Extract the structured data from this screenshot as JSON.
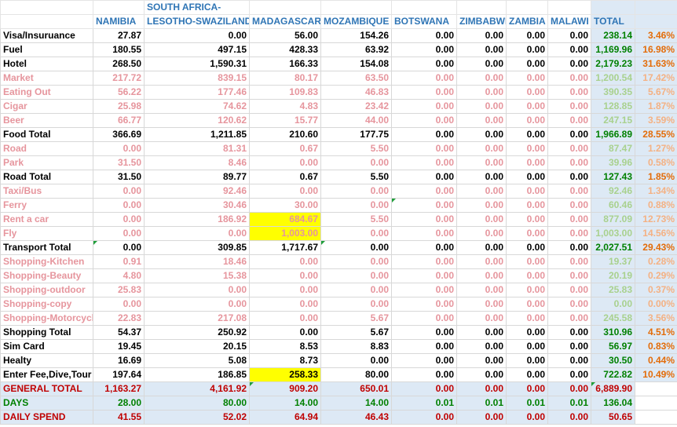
{
  "header": {
    "top": [
      "",
      "",
      "SOUTH AFRICA-",
      "",
      "",
      "",
      "",
      "",
      "",
      "",
      ""
    ],
    "bottom": [
      "",
      "NAMIBIA",
      "LESOTHO-SWAZILAND",
      "MADAGASCAR",
      "MOZAMBIQUE",
      "BOTSWANA",
      "ZIMBABWE",
      "ZAMBIA",
      "MALAWI",
      "TOTAL",
      ""
    ]
  },
  "rows": [
    {
      "style": "major",
      "cells": [
        "Visa/Insuruance",
        "27.87",
        "0.00",
        "56.00",
        "154.26",
        "0.00",
        "0.00",
        "0.00",
        "0.00",
        "238.14",
        "3.46%"
      ]
    },
    {
      "style": "major",
      "cells": [
        "Fuel",
        "180.55",
        "497.15",
        "428.33",
        "63.92",
        "0.00",
        "0.00",
        "0.00",
        "0.00",
        "1,169.96",
        "16.98%"
      ]
    },
    {
      "style": "major",
      "cells": [
        "Hotel",
        "268.50",
        "1,590.31",
        "166.33",
        "154.08",
        "0.00",
        "0.00",
        "0.00",
        "0.00",
        "2,179.23",
        "31.63%"
      ]
    },
    {
      "style": "sub",
      "cells": [
        "Market",
        "217.72",
        "839.15",
        "80.17",
        "63.50",
        "0.00",
        "0.00",
        "0.00",
        "0.00",
        "1,200.54",
        "17.42%"
      ]
    },
    {
      "style": "sub",
      "cells": [
        "Eating Out",
        "56.22",
        "177.46",
        "109.83",
        "46.83",
        "0.00",
        "0.00",
        "0.00",
        "0.00",
        "390.35",
        "5.67%"
      ]
    },
    {
      "style": "sub",
      "cells": [
        "Cigar",
        "25.98",
        "74.62",
        "4.83",
        "23.42",
        "0.00",
        "0.00",
        "0.00",
        "0.00",
        "128.85",
        "1.87%"
      ]
    },
    {
      "style": "sub",
      "cells": [
        "Beer",
        "66.77",
        "120.62",
        "15.77",
        "44.00",
        "0.00",
        "0.00",
        "0.00",
        "0.00",
        "247.15",
        "3.59%"
      ]
    },
    {
      "style": "major",
      "cells": [
        "Food Total",
        "366.69",
        "1,211.85",
        "210.60",
        "177.75",
        "0.00",
        "0.00",
        "0.00",
        "0.00",
        "1,966.89",
        "28.55%"
      ]
    },
    {
      "style": "sub",
      "cells": [
        "Road",
        "0.00",
        "81.31",
        "0.67",
        "5.50",
        "0.00",
        "0.00",
        "0.00",
        "0.00",
        "87.47",
        "1.27%"
      ]
    },
    {
      "style": "sub",
      "cells": [
        "Park",
        "31.50",
        "8.46",
        "0.00",
        "0.00",
        "0.00",
        "0.00",
        "0.00",
        "0.00",
        "39.96",
        "0.58%"
      ]
    },
    {
      "style": "major",
      "cells": [
        "Road Total",
        "31.50",
        "89.77",
        "0.67",
        "5.50",
        "0.00",
        "0.00",
        "0.00",
        "0.00",
        "127.43",
        "1.85%"
      ]
    },
    {
      "style": "sub",
      "cells": [
        "Taxi/Bus",
        "0.00",
        "92.46",
        "0.00",
        "0.00",
        "0.00",
        "0.00",
        "0.00",
        "0.00",
        "92.46",
        "1.34%"
      ]
    },
    {
      "style": "sub",
      "cells": [
        "Ferry",
        "0.00",
        "30.46",
        "30.00",
        "0.00",
        "0.00",
        "0.00",
        "0.00",
        "0.00",
        "60.46",
        "0.88%"
      ]
    },
    {
      "style": "sub",
      "cells": [
        "Rent a car",
        "0.00",
        "186.92",
        "684.67",
        "5.50",
        "0.00",
        "0.00",
        "0.00",
        "0.00",
        "877.09",
        "12.73%"
      ]
    },
    {
      "style": "sub",
      "cells": [
        "Fly",
        "0.00",
        "0.00",
        "1,003.00",
        "0.00",
        "0.00",
        "0.00",
        "0.00",
        "0.00",
        "1,003.00",
        "14.56%"
      ]
    },
    {
      "style": "major",
      "cells": [
        "Transport Total",
        "0.00",
        "309.85",
        "1,717.67",
        "0.00",
        "0.00",
        "0.00",
        "0.00",
        "0.00",
        "2,027.51",
        "29.43%"
      ]
    },
    {
      "style": "sub",
      "cells": [
        "Shopping-Kitchen",
        "0.91",
        "18.46",
        "0.00",
        "0.00",
        "0.00",
        "0.00",
        "0.00",
        "0.00",
        "19.37",
        "0.28%"
      ]
    },
    {
      "style": "sub",
      "cells": [
        "Shopping-Beauty",
        "4.80",
        "15.38",
        "0.00",
        "0.00",
        "0.00",
        "0.00",
        "0.00",
        "0.00",
        "20.19",
        "0.29%"
      ]
    },
    {
      "style": "sub",
      "cells": [
        "Shopping-outdoor",
        "25.83",
        "0.00",
        "0.00",
        "0.00",
        "0.00",
        "0.00",
        "0.00",
        "0.00",
        "25.83",
        "0.37%"
      ]
    },
    {
      "style": "sub",
      "cells": [
        "Shopping-copy",
        "0.00",
        "0.00",
        "0.00",
        "0.00",
        "0.00",
        "0.00",
        "0.00",
        "0.00",
        "0.00",
        "0.00%"
      ]
    },
    {
      "style": "sub",
      "cells": [
        "Shopping-Motorcycle",
        "22.83",
        "217.08",
        "0.00",
        "5.67",
        "0.00",
        "0.00",
        "0.00",
        "0.00",
        "245.58",
        "3.56%"
      ]
    },
    {
      "style": "major",
      "cells": [
        "Shopping Total",
        "54.37",
        "250.92",
        "0.00",
        "5.67",
        "0.00",
        "0.00",
        "0.00",
        "0.00",
        "310.96",
        "4.51%"
      ]
    },
    {
      "style": "major",
      "cells": [
        "Sim Card",
        "19.45",
        "20.15",
        "8.53",
        "8.83",
        "0.00",
        "0.00",
        "0.00",
        "0.00",
        "56.97",
        "0.83%"
      ]
    },
    {
      "style": "major",
      "cells": [
        "Healty",
        "16.69",
        "5.08",
        "8.73",
        "0.00",
        "0.00",
        "0.00",
        "0.00",
        "0.00",
        "30.50",
        "0.44%"
      ]
    },
    {
      "style": "major",
      "cells": [
        "Enter Fee,Dive,Tour",
        "197.64",
        "186.85",
        "258.33",
        "80.00",
        "0.00",
        "0.00",
        "0.00",
        "0.00",
        "722.82",
        "10.49%"
      ]
    },
    {
      "style": "gt",
      "cells": [
        "GENERAL TOTAL",
        "1,163.27",
        "4,161.92",
        "909.20",
        "650.01",
        "0.00",
        "0.00",
        "0.00",
        "0.00",
        "6,889.90",
        ""
      ]
    },
    {
      "style": "days",
      "cells": [
        "DAYS",
        "28.00",
        "80.00",
        "14.00",
        "14.00",
        "0.01",
        "0.01",
        "0.01",
        "0.01",
        "136.04",
        ""
      ]
    },
    {
      "style": "daily",
      "cells": [
        "DAILY SPEND",
        "41.55",
        "52.02",
        "64.94",
        "46.43",
        "0.00",
        "0.00",
        "0.00",
        "0.00",
        "50.65",
        ""
      ]
    }
  ],
  "highlighted_cells": [
    [
      13,
      3
    ],
    [
      14,
      3
    ],
    [
      24,
      3
    ]
  ],
  "comment_marks": [
    [
      12,
      5
    ],
    [
      15,
      1
    ],
    [
      15,
      4
    ],
    [
      25,
      3
    ],
    [
      25,
      9
    ]
  ],
  "colors": {
    "header_blue": "#2f75b5",
    "total_green": "#008000",
    "pct_orange": "#e36c09",
    "subitem_pink": "#e6959d",
    "general_total_red": "#c00000",
    "highlight_yellow": "#ffff00",
    "total_column_bg": "#dde9f5"
  }
}
